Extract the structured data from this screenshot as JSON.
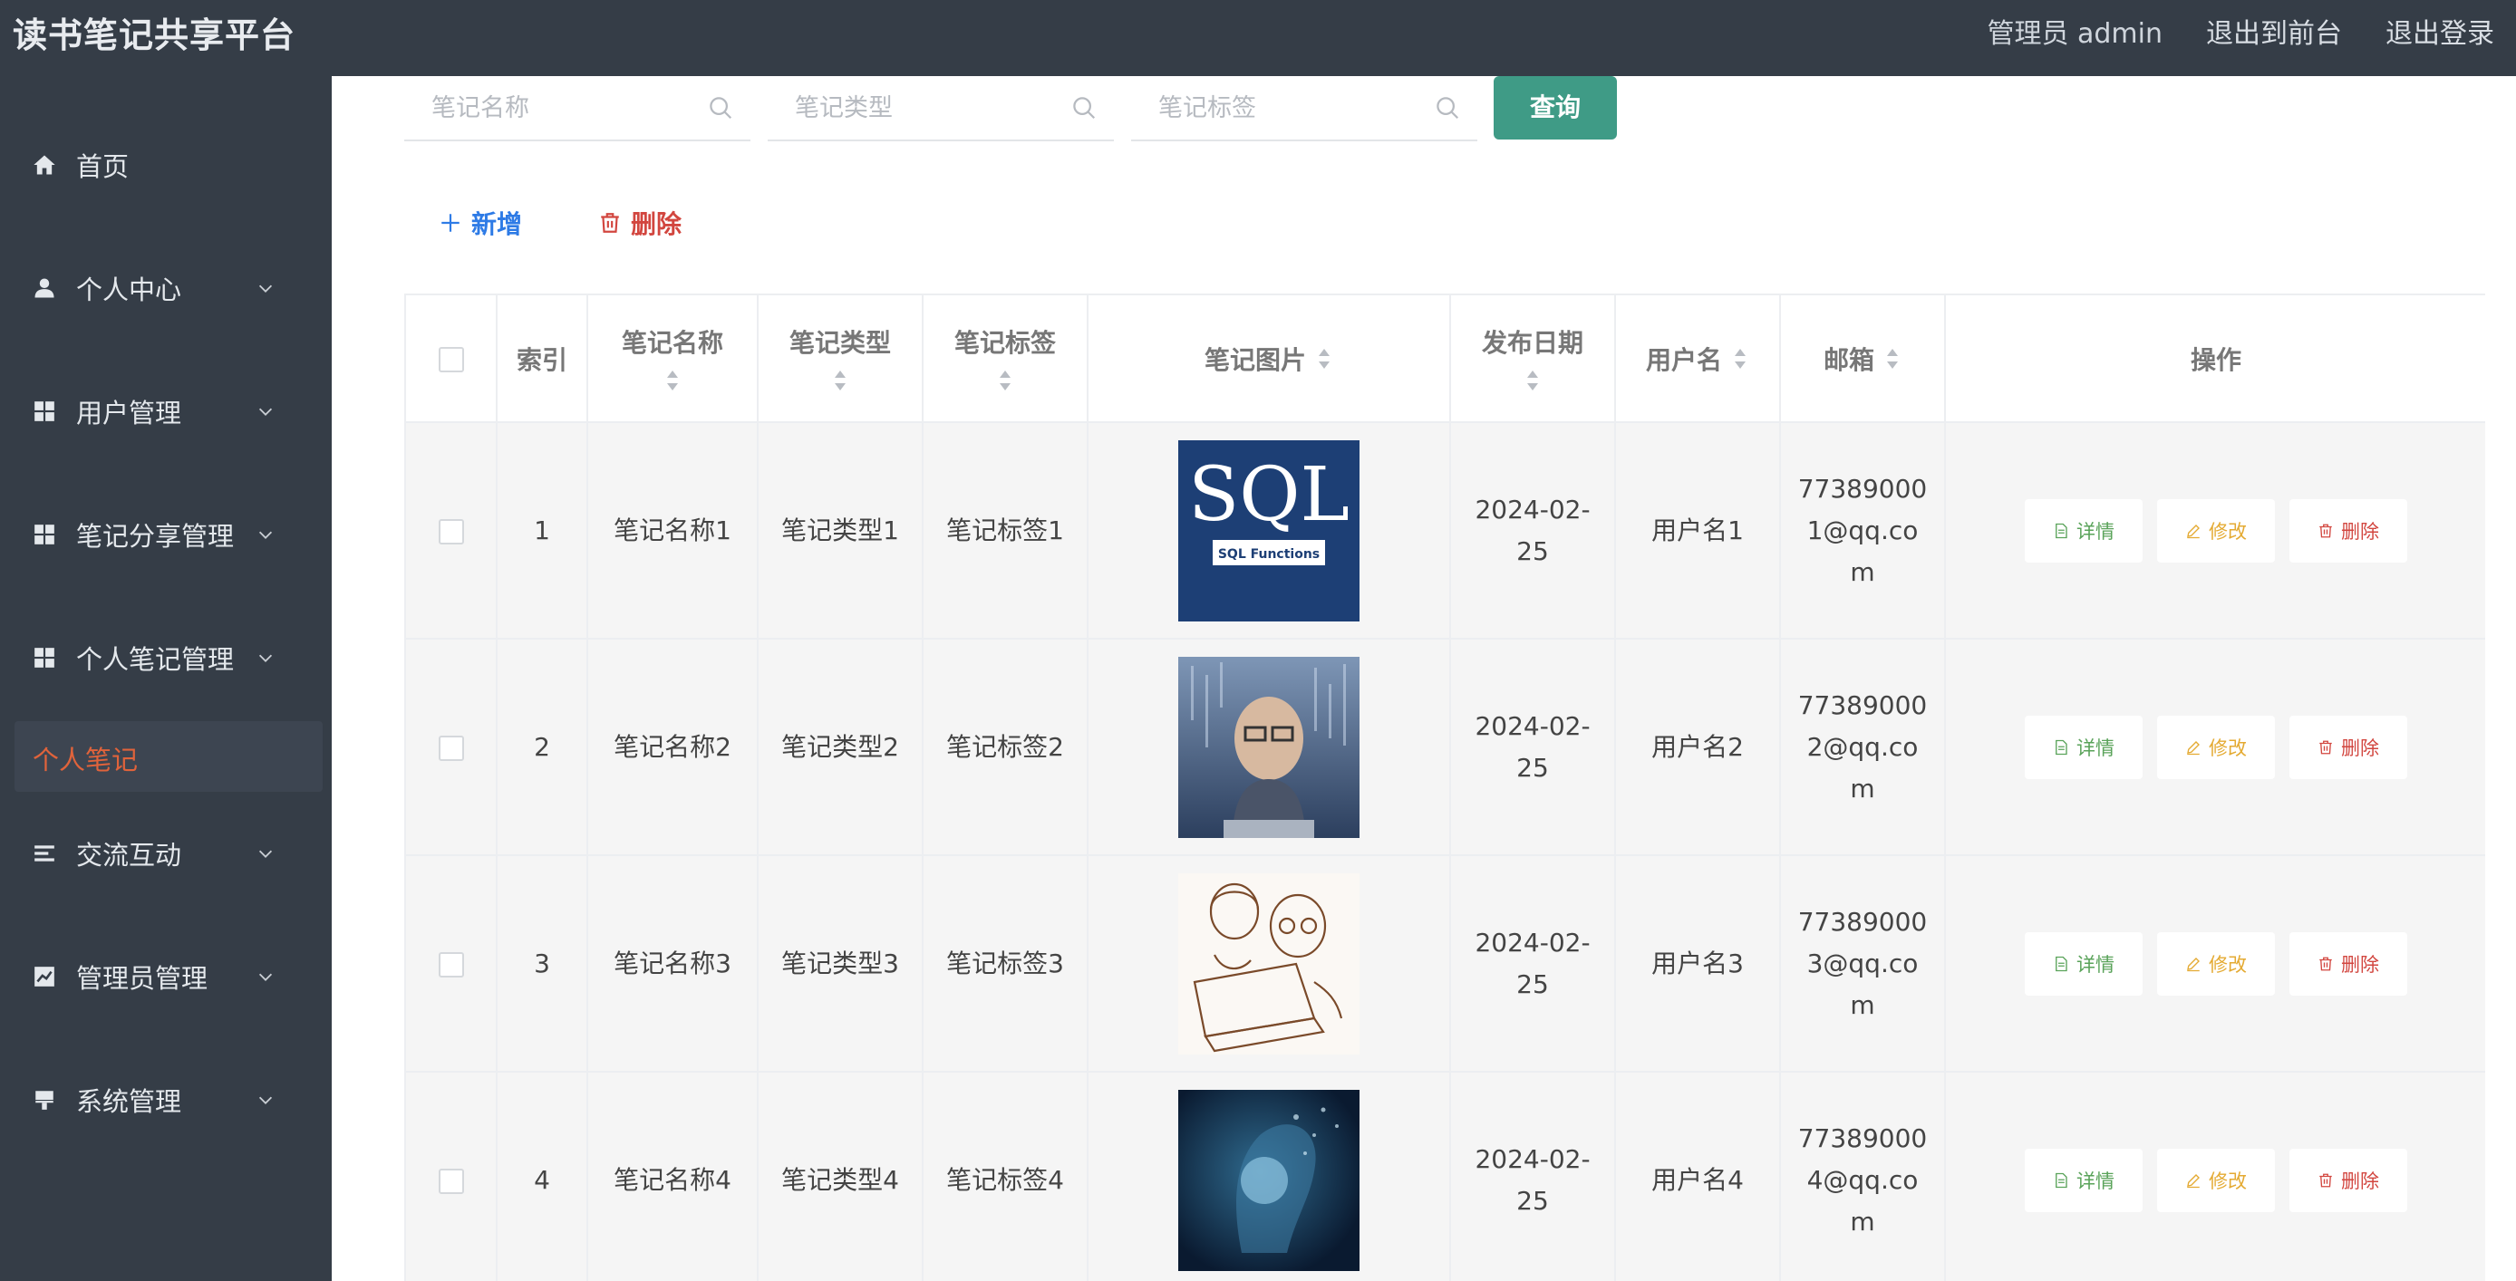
{
  "header": {
    "title": "读书笔记共享平台",
    "admin_label": "管理员 admin",
    "front_link": "退出到前台",
    "logout_link": "退出登录"
  },
  "sidebar": {
    "items": [
      {
        "label": "首页",
        "icon": "home-icon"
      },
      {
        "label": "个人中心",
        "icon": "user-icon"
      },
      {
        "label": "用户管理",
        "icon": "grid-icon"
      },
      {
        "label": "笔记分享管理",
        "icon": "grid-icon"
      },
      {
        "label": "个人笔记管理",
        "icon": "grid-icon"
      },
      {
        "label": "交流互动",
        "icon": "list-icon"
      },
      {
        "label": "管理员管理",
        "icon": "chart-icon"
      },
      {
        "label": "系统管理",
        "icon": "brush-icon"
      }
    ],
    "active_sub": "个人笔记"
  },
  "search": {
    "name_placeholder": "笔记名称",
    "type_placeholder": "笔记类型",
    "tag_placeholder": "笔记标签",
    "query_label": "查询"
  },
  "toolbar": {
    "add_label": "新增",
    "delete_label": "删除"
  },
  "colors": {
    "sidebar_bg": "#353d47",
    "accent_green": "#3f9b86",
    "active_orange": "#e0633b",
    "add_blue": "#2e7be6",
    "delete_red": "#d2463f"
  },
  "table": {
    "headers": {
      "index": "索引",
      "name": "笔记名称",
      "type": "笔记类型",
      "tag": "笔记标签",
      "image": "笔记图片",
      "date": "发布日期",
      "username": "用户名",
      "email": "邮箱",
      "ops": "操作"
    },
    "op_labels": {
      "detail": "详情",
      "edit": "修改",
      "delete": "删除"
    },
    "rows": [
      {
        "index": "1",
        "name": "笔记名称1",
        "type": "笔记类型1",
        "tag": "笔记标签1",
        "image": "SQL Functions",
        "date": "2024-02-25",
        "username": "用户名1",
        "email": "773890001@qq.com"
      },
      {
        "index": "2",
        "name": "笔记名称2",
        "type": "笔记类型2",
        "tag": "笔记标签2",
        "image": "",
        "date": "2024-02-25",
        "username": "用户名2",
        "email": "773890002@qq.com"
      },
      {
        "index": "3",
        "name": "笔记名称3",
        "type": "笔记类型3",
        "tag": "笔记标签3",
        "image": "",
        "date": "2024-02-25",
        "username": "用户名3",
        "email": "773890003@qq.com"
      },
      {
        "index": "4",
        "name": "笔记名称4",
        "type": "笔记类型4",
        "tag": "笔记标签4",
        "image": "",
        "date": "2024-02-25",
        "username": "用户名4",
        "email": "773890004@qq.com"
      }
    ]
  }
}
